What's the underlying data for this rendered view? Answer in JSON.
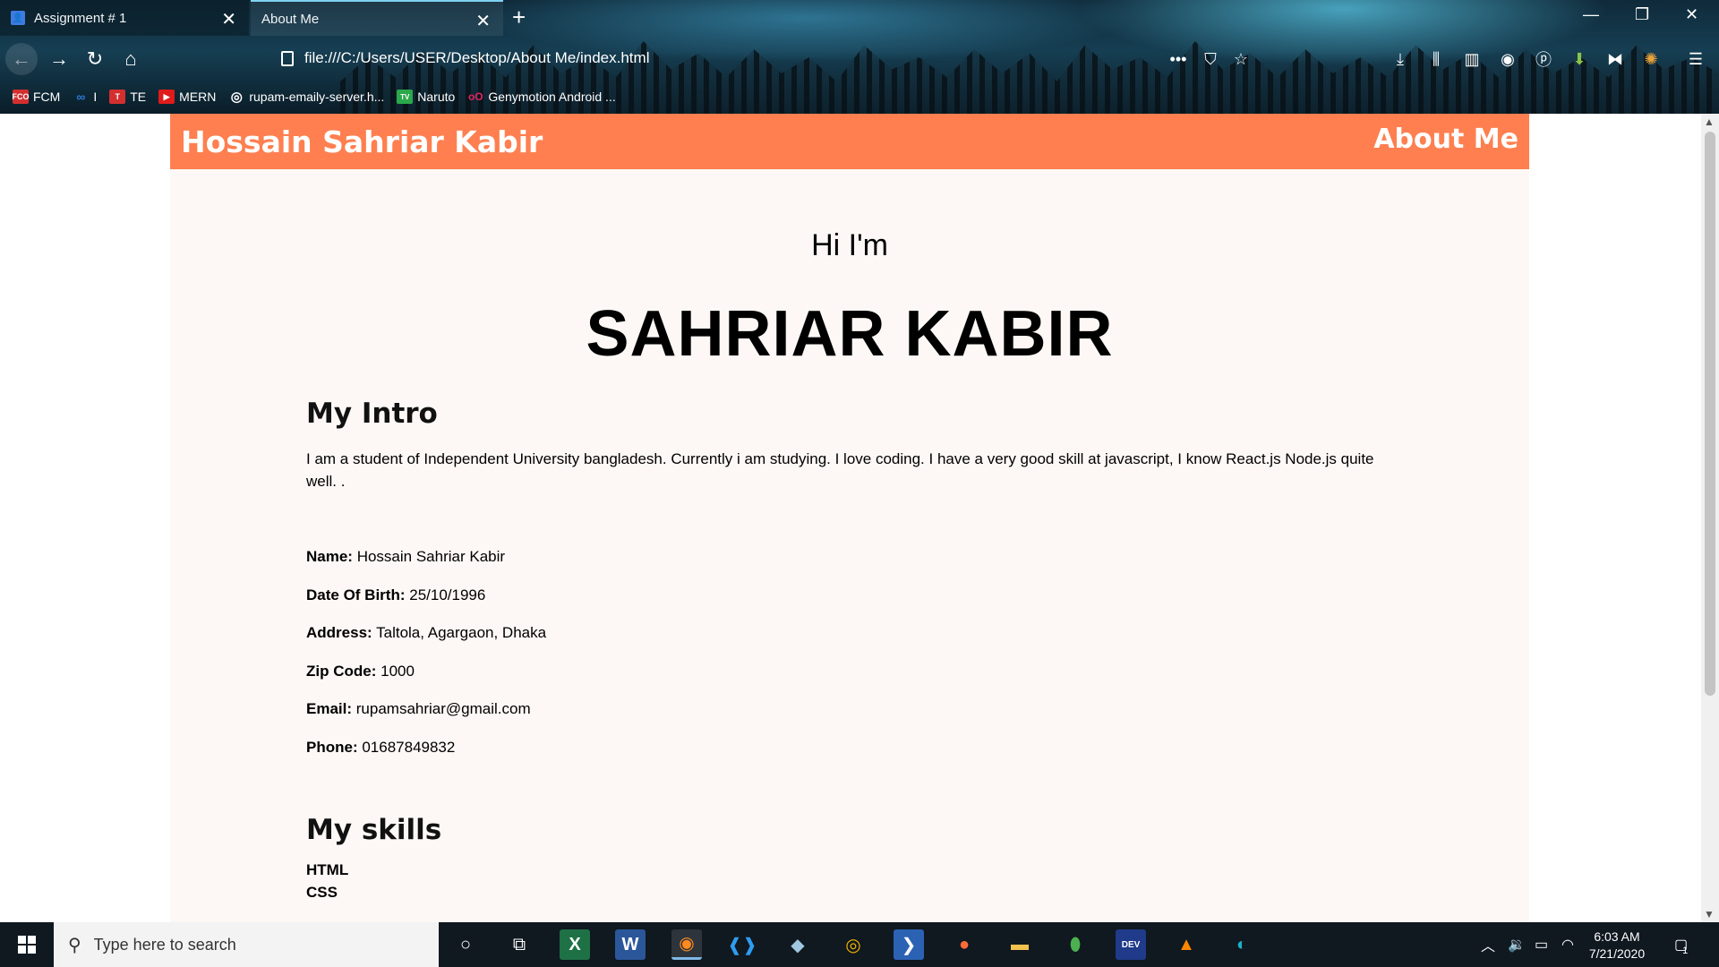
{
  "browser": {
    "tabs": [
      {
        "label": "Assignment # 1"
      },
      {
        "label": "About Me"
      }
    ],
    "url": "file:///C:/Users/USER/Desktop/About Me/index.html",
    "bookmarks": [
      {
        "label": "FCM",
        "icon": "fcm-icon",
        "color": "#d32f2f",
        "badge": "FCO"
      },
      {
        "label": "I",
        "icon": "infinity-icon",
        "color": "#2b7bd6",
        "badge": "∞"
      },
      {
        "label": "TE",
        "icon": "te-icon",
        "color": "#d32f2f",
        "badge": "T"
      },
      {
        "label": "MERN",
        "icon": "youtube-icon",
        "color": "#e01b1b",
        "badge": "▶"
      },
      {
        "label": "rupam-emaily-server.h...",
        "icon": "globe-icon",
        "color": "#555555",
        "badge": "◎"
      },
      {
        "label": "Naruto",
        "icon": "tv-icon",
        "color": "#2aa84a",
        "badge": "TV"
      },
      {
        "label": "Genymotion Android ...",
        "icon": "genymotion-icon",
        "color": "#e0245e",
        "badge": "oO"
      }
    ]
  },
  "site": {
    "brand": "Hossain Sahriar Kabir",
    "nav_link": "About Me",
    "greeting": "Hi I'm",
    "name": "SAHRIAR KABIR",
    "intro_heading": "My Intro",
    "intro_text": "I am a student of Independent University bangladesh. Currently i am studying. I love coding. I have a very good skill at javascript, I know React.js Node.js quite well. .",
    "details": [
      {
        "label": "Name:",
        "value": "Hossain Sahriar Kabir"
      },
      {
        "label": "Date Of Birth:",
        "value": "25/10/1996"
      },
      {
        "label": "Address:",
        "value": "Taltola, Agargaon, Dhaka"
      },
      {
        "label": "Zip Code:",
        "value": "1000"
      },
      {
        "label": "Email:",
        "value": "rupamsahriar@gmail.com"
      },
      {
        "label": "Phone:",
        "value": "01687849832"
      }
    ],
    "skills_heading": "My skills",
    "skills": [
      "HTML",
      "CSS"
    ],
    "colors": {
      "header": "#ff7f50",
      "background": "#fdf8f5"
    }
  },
  "taskbar": {
    "search_placeholder": "Type here to search",
    "time": "6:03 AM",
    "date": "7/21/2020",
    "notification_count": "1"
  }
}
